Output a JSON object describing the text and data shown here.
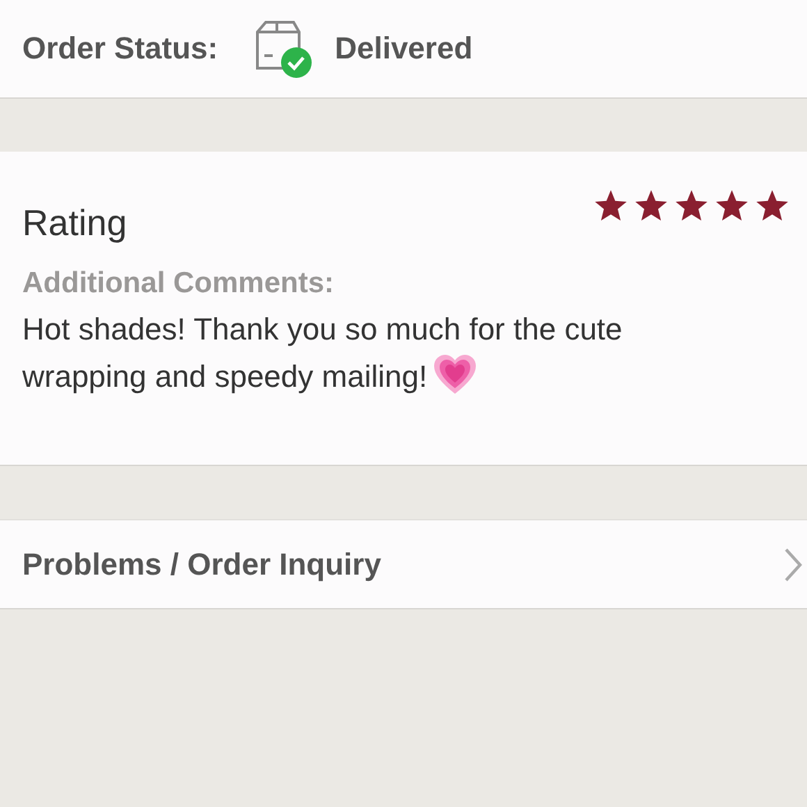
{
  "order_status": {
    "label": "Order Status:",
    "value": "Delivered",
    "delivered": true
  },
  "rating": {
    "title": "Rating",
    "stars": 5,
    "comments_label": "Additional Comments:",
    "comment": "Hot shades! Thank you so much for the cute wrapping and speedy mailing!"
  },
  "inquiry": {
    "label": "Problems / Order Inquiry"
  }
}
